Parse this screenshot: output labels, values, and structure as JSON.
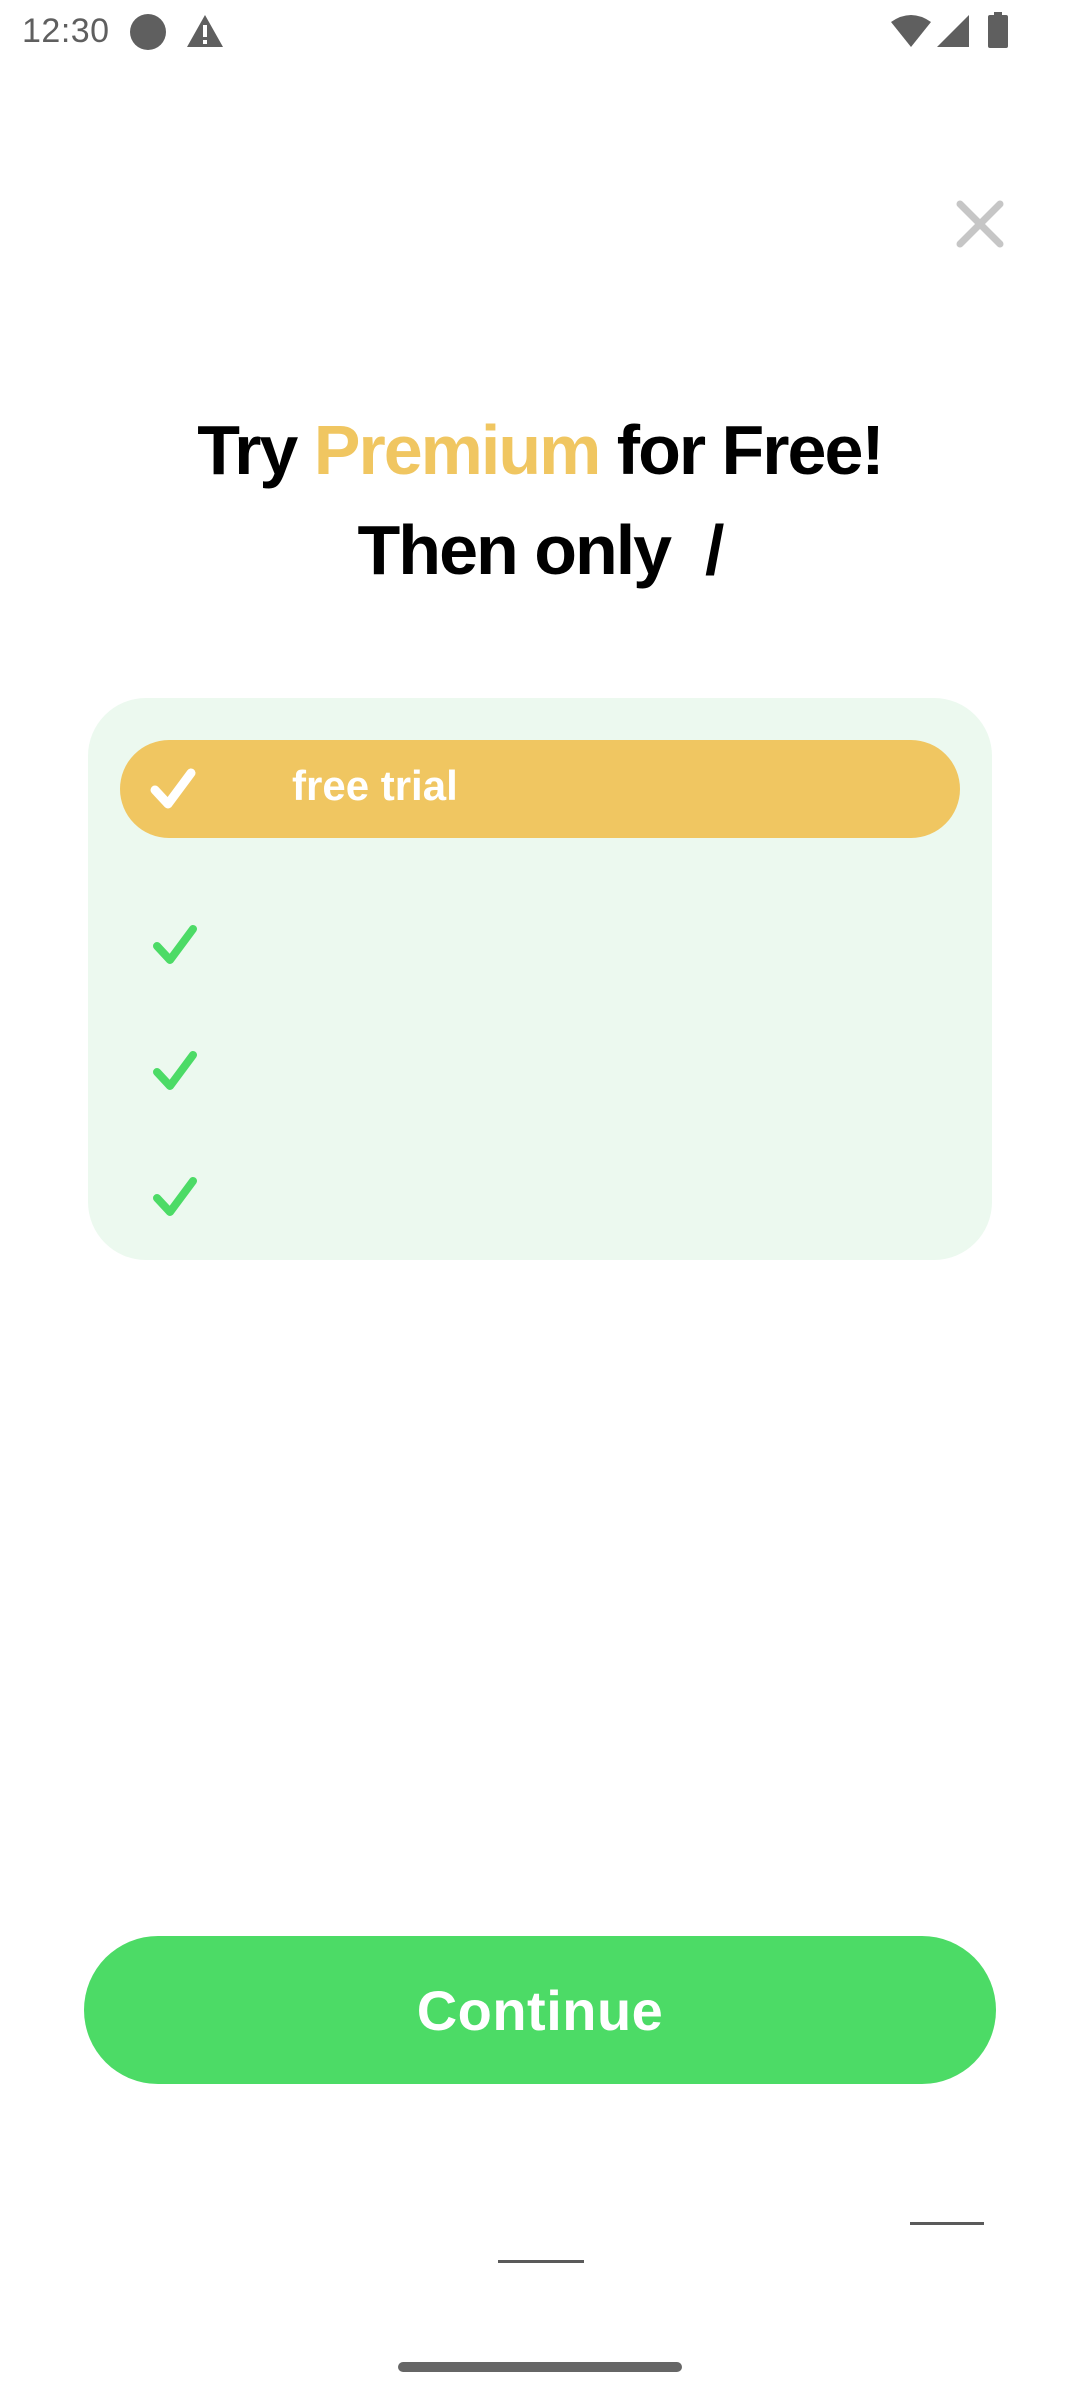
{
  "status_bar": {
    "time": "12:30",
    "icons": [
      "dot-icon",
      "warning-icon",
      "wifi-icon",
      "cell-signal-icon",
      "battery-icon"
    ]
  },
  "close": {
    "icon": "close-icon"
  },
  "headline": {
    "prefix": "Try ",
    "accent": "Premium",
    "suffix": " for Free!",
    "line2_prefix": "Then only ",
    "line2_price": "",
    "line2_separator": "/",
    "line2_period": ""
  },
  "features": {
    "highlight": {
      "label": "free trial",
      "icon": "check-icon"
    },
    "items": [
      {
        "label": "",
        "icon": "check-icon"
      },
      {
        "label": "",
        "icon": "check-icon"
      },
      {
        "label": "",
        "icon": "check-icon"
      }
    ]
  },
  "cta": {
    "label": "Continue"
  },
  "footer": {
    "link_right": "",
    "link_center": ""
  },
  "colors": {
    "accent_yellow": "#f0c661",
    "brand_green": "#4cdb66",
    "card_bg": "#ecf9ef",
    "check_green": "#4cdb66"
  }
}
